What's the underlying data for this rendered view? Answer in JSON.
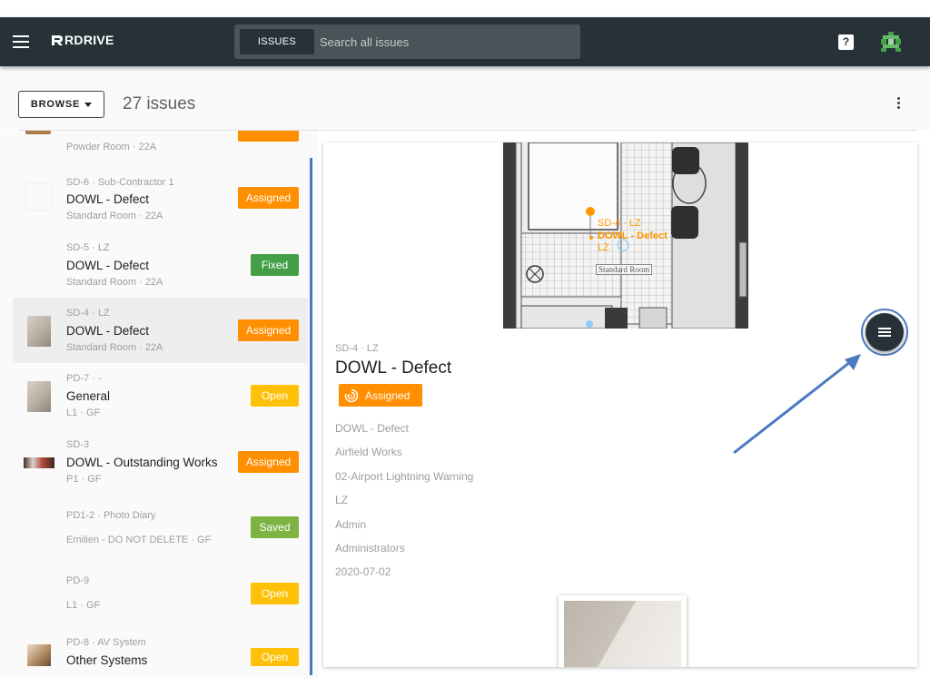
{
  "app": {
    "brand": "RDRIVE"
  },
  "search": {
    "scope_label": "ISSUES",
    "placeholder": "Search all issues"
  },
  "toolbar": {
    "browse_label": "BROWSE",
    "issue_count": "27 issues"
  },
  "issues": [
    {
      "subtitle": "",
      "title": "",
      "location": "Powder Room · 22A",
      "status": "",
      "status_type": "assigned",
      "selected": false
    },
    {
      "subtitle": "SD-6 · Sub-Contractor 1",
      "title": "DOWL - Defect",
      "location": "Standard Room · 22A",
      "status": "Assigned",
      "status_type": "assigned",
      "selected": false
    },
    {
      "subtitle": "SD-5 · LZ",
      "title": "DOWL - Defect",
      "location": "Standard Room · 22A",
      "status": "Fixed",
      "status_type": "fixed",
      "selected": false
    },
    {
      "subtitle": "SD-4 · LZ",
      "title": "DOWL - Defect",
      "location": "Standard Room · 22A",
      "status": "Assigned",
      "status_type": "assigned",
      "selected": true
    },
    {
      "subtitle": "PD-7 · -",
      "title": "General",
      "location": "L1 · GF",
      "status": "Open",
      "status_type": "open",
      "selected": false
    },
    {
      "subtitle": "SD-3",
      "title": "DOWL - Outstanding Works",
      "location": "P1 · GF",
      "status": "Assigned",
      "status_type": "assigned",
      "selected": false
    },
    {
      "subtitle": "PD1-2 · Photo Diary",
      "title": "",
      "location": "Emilien - DO NOT DELETE · GF",
      "status": "Saved",
      "status_type": "saved",
      "selected": false
    },
    {
      "subtitle": "PD-9",
      "title": "",
      "location": "L1 · GF",
      "status": "Open",
      "status_type": "open",
      "selected": false
    },
    {
      "subtitle": "PD-8 · AV System",
      "title": "Other Systems",
      "location": "",
      "status": "Open",
      "status_type": "open",
      "selected": false
    }
  ],
  "detail": {
    "plan_pin_label_1": "SD-4 · LZ",
    "plan_pin_label_2": "DOWL - Defect",
    "plan_pin_label_3": "LZ",
    "plan_room": "Standard Room",
    "subtitle": "SD-4 · LZ",
    "title": "DOWL - Defect",
    "status": "Assigned",
    "fields": [
      "DOWL - Defect",
      "Airfield Works",
      "02-Airport Lightning Warning",
      "LZ",
      "Admin",
      "Administrators",
      "2020-07-02"
    ]
  },
  "colors": {
    "appbar": "#263238",
    "assigned": "#ff8f00",
    "fixed": "#43a047",
    "open": "#ffc107",
    "saved": "#7cb342",
    "annotation": "#4a7ac0"
  },
  "icons": [
    "menu-icon",
    "rdrive-logo-icon",
    "help-icon",
    "user-avatar-icon",
    "dropdown-caret-icon",
    "more-vert-icon",
    "assigned-status-icon",
    "fab-menu-icon"
  ]
}
